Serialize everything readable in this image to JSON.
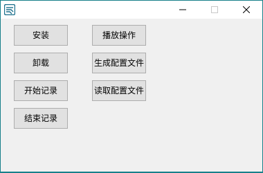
{
  "window": {
    "app_icon": "app-logo-icon",
    "controls": {
      "minimize_icon": "minimize-icon",
      "maximize_icon": "maximize-icon",
      "close_icon": "close-icon"
    }
  },
  "buttons": {
    "install": "安装",
    "uninstall": "卸载",
    "start_record": "开始记录",
    "stop_record": "结束记录",
    "playback": "播放操作",
    "generate_config": "生成配置文件",
    "read_config": "读取配置文件"
  },
  "colors": {
    "window_border": "#17808a",
    "client_bg": "#f0f0f0",
    "button_bg": "#e1e1e1",
    "button_border": "#adadad"
  }
}
